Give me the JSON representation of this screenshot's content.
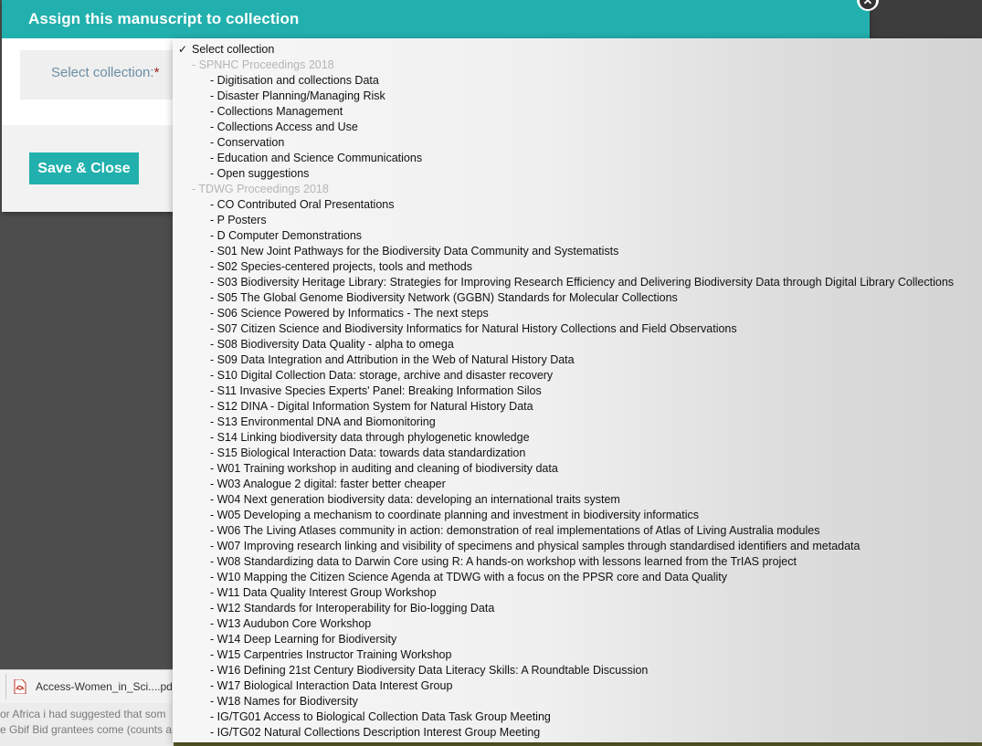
{
  "modal": {
    "title": "Assign this manuscript to collection",
    "close_glyph": "✕",
    "field_label": "Select collection:",
    "required_mark": "*",
    "save_label": "Save & Close"
  },
  "dropdown": {
    "selected_label": "Select collection",
    "check_glyph": "✓",
    "groups": [
      {
        "label": "- SPNHC Proceedings 2018",
        "items": [
          "- Digitisation and collections Data",
          "- Disaster Planning/Managing Risk",
          "- Collections Management",
          "- Collections Access and Use",
          "- Conservation",
          "- Education and Science Communications",
          "- Open suggestions"
        ]
      },
      {
        "label": "- TDWG Proceedings 2018",
        "items": [
          "- CO Contributed Oral Presentations",
          "- P Posters",
          "- D Computer Demonstrations",
          "- S01 New Joint Pathways for the Biodiversity Data Community and Systematists",
          "- S02 Species-centered projects, tools and methods",
          "- S03 Biodiversity Heritage Library: Strategies for Improving Research Efficiency and Delivering Biodiversity Data through Digital Library Collections",
          "- S05 The Global Genome Biodiversity Network (GGBN) Standards for Molecular Collections",
          "- S06 Science Powered by Informatics - The next steps",
          "- S07 Citizen Science and Biodiversity Informatics for Natural History Collections and Field Observations",
          "- S08 Biodiversity Data Quality - alpha to omega",
          "- S09 Data Integration and Attribution in the Web of Natural History Data",
          "- S10 Digital Collection Data: storage, archive and disaster recovery",
          "- S11 Invasive Species Experts' Panel: Breaking Information Silos",
          "- S12 DINA - Digital Information System for Natural History Data",
          "- S13 Environmental DNA and Biomonitoring",
          "- S14 Linking biodiversity data through phylogenetic knowledge",
          "- S15 Biological Interaction Data: towards data standardization",
          "- W01 Training workshop in auditing and cleaning of biodiversity data",
          "- W03 Analogue 2 digital: faster better cheaper",
          "- W04 Next generation biodiversity data: developing an international traits system",
          "- W05 Developing a mechanism to coordinate planning and investment in biodiversity informatics",
          "- W06 The Living Atlases community in action: demonstration of real implementations of Atlas of Living Australia modules",
          "- W07 Improving research linking and visibility of specimens and physical samples through standardised identifiers and metadata",
          "- W08 Standardizing data to Darwin Core using R: A hands-on workshop with lessons learned from the TrIAS project",
          "- W10 Mapping the Citizen Science Agenda at TDWG with a focus on the PPSR core and Data Quality",
          "- W11 Data Quality Interest Group Workshop",
          "- W12 Standards for Interoperability for Bio-logging Data",
          "- W13 Audubon Core Workshop",
          "- W14 Deep Learning for Biodiversity",
          "- W15 Carpentries Instructor Training Workshop",
          "- W16 Defining 21st Century Biodiversity Data Literacy Skills: A Roundtable Discussion",
          "- W17 Biological Interaction Data Interest Group",
          "- W18 Names for Biodiversity",
          "- IG/TG01 Access to Biological Collection Data Task Group Meeting",
          "- IG/TG02 Natural Collections Description Interest Group Meeting"
        ]
      }
    ]
  },
  "background": {
    "download_file": "Access-Women_in_Sci....pdf",
    "text_lines": [
      "or Africa i had suggested that som",
      "e Gbif Bid grantees come (counts a"
    ]
  },
  "colors": {
    "accent": "#21b0ad",
    "label": "#6b8ea5",
    "required": "#9b1d1d",
    "group_text": "#b5b5b5"
  }
}
